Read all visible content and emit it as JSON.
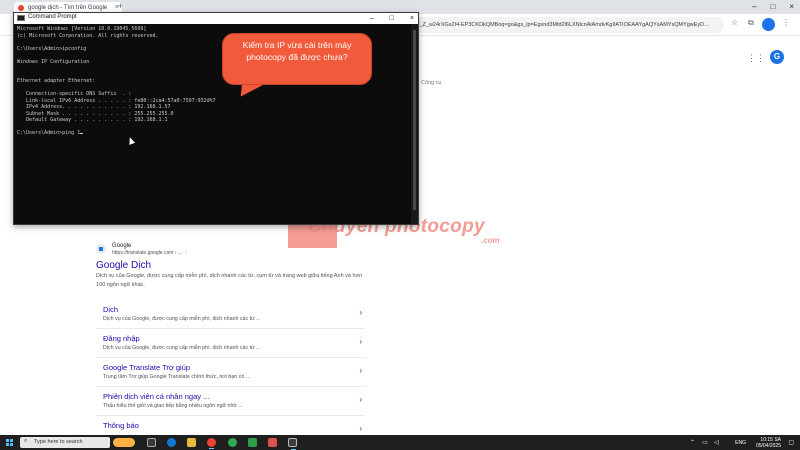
{
  "browser": {
    "tab_title": "google dịch - Tìm trên Google",
    "tab_close": "×",
    "new_tab": "+",
    "window_controls": {
      "minimize": "–",
      "maximize": "□",
      "close": "×"
    },
    "url": "…v=_Z_w24rXGs2I4-EP3CKDkQMBoq=go&gs_lp=Egxnd3Mtd2l6LXNlcnAiAmdvKgIIATIOEAAYgAQYsAMYsQMYgwEyD…"
  },
  "google_page": {
    "avatar_letter": "G",
    "tools_label": "Công cụ",
    "result": {
      "site_name": "Google",
      "site_url": "https://translate.google.com › ...",
      "more_icon": "⋮",
      "title": "Google Dịch",
      "snippet": "Dịch vụ của Google, được cung cấp miễn phí, dịch nhanh các từ, cụm từ và trang web giữa tiếng Anh và hơn 100 ngôn ngữ khác."
    },
    "sitelinks": [
      {
        "title": "Dịch",
        "desc": "Dịch vụ của Google, được cung cấp miễn phí, dịch nhanh các từ ..."
      },
      {
        "title": "Đăng nhập",
        "desc": "Dịch vụ của Google, được cung cấp miễn phí, dịch nhanh các từ ..."
      },
      {
        "title": "Google Translate Trợ giúp",
        "desc": "Trung tâm Trợ giúp Google Translate chính thức, nơi bạn có ..."
      },
      {
        "title": "Phiên dịch viên cá nhân ngay ...",
        "desc": "Thấu hiểu thế giới và giao tiếp bằng nhiều ngôn ngữ nhờ ..."
      },
      {
        "title": "Thông báo",
        "desc": ""
      }
    ],
    "chevron": "›"
  },
  "watermark": {
    "text": "Chuyen photocopy",
    "suffix": ".com"
  },
  "cmd": {
    "title": "Command Prompt",
    "controls": {
      "minimize": "–",
      "maximize": "□",
      "close": "×"
    },
    "lines": [
      "Microsoft Windows [Version 10.0.19045.5608]",
      "(c) Microsoft Corporation. All rights reserved.",
      "",
      "C:\\Users\\Admin>ipconfig",
      "",
      "Windows IP Configuration",
      "",
      "",
      "Ethernet adapter Ethernet:",
      "",
      "   Connection-specific DNS Suffix  . :",
      "   Link-local IPv6 Address . . . . . : fe80::2ca4:57a0:7507:932d%7",
      "   IPv4 Address. . . . . . . . . . . : 192.168.1.57",
      "   Subnet Mask . . . . . . . . . . . : 255.255.255.0",
      "   Default Gateway . . . . . . . . . : 192.168.1.1",
      "",
      "C:\\Users\\Admin>ping 1"
    ]
  },
  "bubble": {
    "text": "Kiểm tra IP vừa cài trên máy photocopy đã được chưa?"
  },
  "taskbar": {
    "search_placeholder": "Type here to search",
    "language": "ENG",
    "time": "10:15 SA",
    "date": "05/04/2025"
  }
}
